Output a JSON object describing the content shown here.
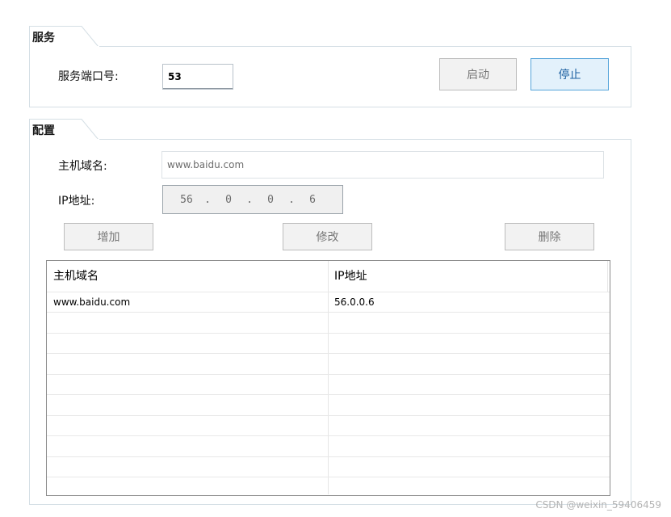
{
  "service": {
    "title": "服务",
    "port_label": "服务端口号:",
    "port_value": "53",
    "start_label": "启动",
    "stop_label": "停止"
  },
  "config": {
    "title": "配置",
    "domain_label": "主机域名:",
    "domain_value": "www.baidu.com",
    "ip_label": "IP地址:",
    "ip_octets": [
      "56",
      "0",
      "0",
      "6"
    ],
    "add_label": "增加",
    "modify_label": "修改",
    "delete_label": "删除"
  },
  "table": {
    "columns": [
      "主机域名",
      "IP地址"
    ],
    "rows": [
      [
        "www.baidu.com",
        "56.0.0.6"
      ]
    ]
  },
  "watermark": "CSDN @weixin_59406459",
  "colors": {
    "group_border": "#d5dfe5",
    "active_button_border": "#57a5da",
    "active_button_bg": "#e3f1fb"
  }
}
